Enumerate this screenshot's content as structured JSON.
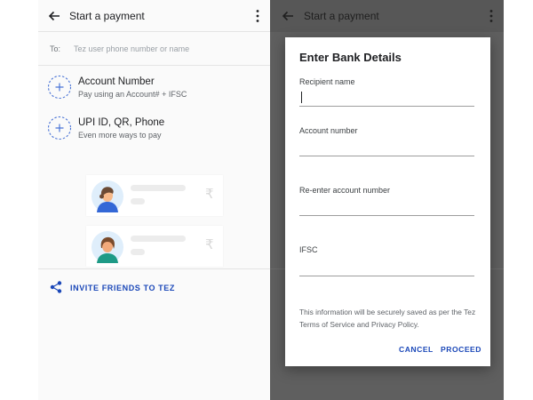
{
  "left_screen": {
    "title": "Start a payment",
    "to_label": "To:",
    "to_placeholder": "Tez user phone number or name",
    "options": [
      {
        "title": "Account Number",
        "subtitle": "Pay using an Account# + IFSC",
        "icon": "add-circle-icon"
      },
      {
        "title": "UPI ID, QR, Phone",
        "subtitle": "Even more ways to pay",
        "icon": "add-circle-icon"
      }
    ],
    "currency_symbol": "₹",
    "invite_label": "INVITE FRIENDS TO TEZ",
    "icons": {
      "back": "back-arrow-icon",
      "menu": "more-vert-icon",
      "share": "share-icon"
    }
  },
  "right_screen": {
    "title": "Start a payment"
  },
  "dialog": {
    "title": "Enter Bank Details",
    "fields": [
      {
        "label": "Recipient name",
        "value": ""
      },
      {
        "label": "Account number",
        "value": ""
      },
      {
        "label": "Re-enter account number",
        "value": ""
      },
      {
        "label": "IFSC",
        "value": ""
      }
    ],
    "info_text": "This information will be securely saved as per the Tez Terms of Service and Privacy Policy.",
    "cancel_label": "CANCEL",
    "proceed_label": "PROCEED"
  },
  "colors": {
    "accent": "#1a47b8",
    "dashed_circle": "#4a74d6",
    "overlay": "#5f5f5f"
  }
}
